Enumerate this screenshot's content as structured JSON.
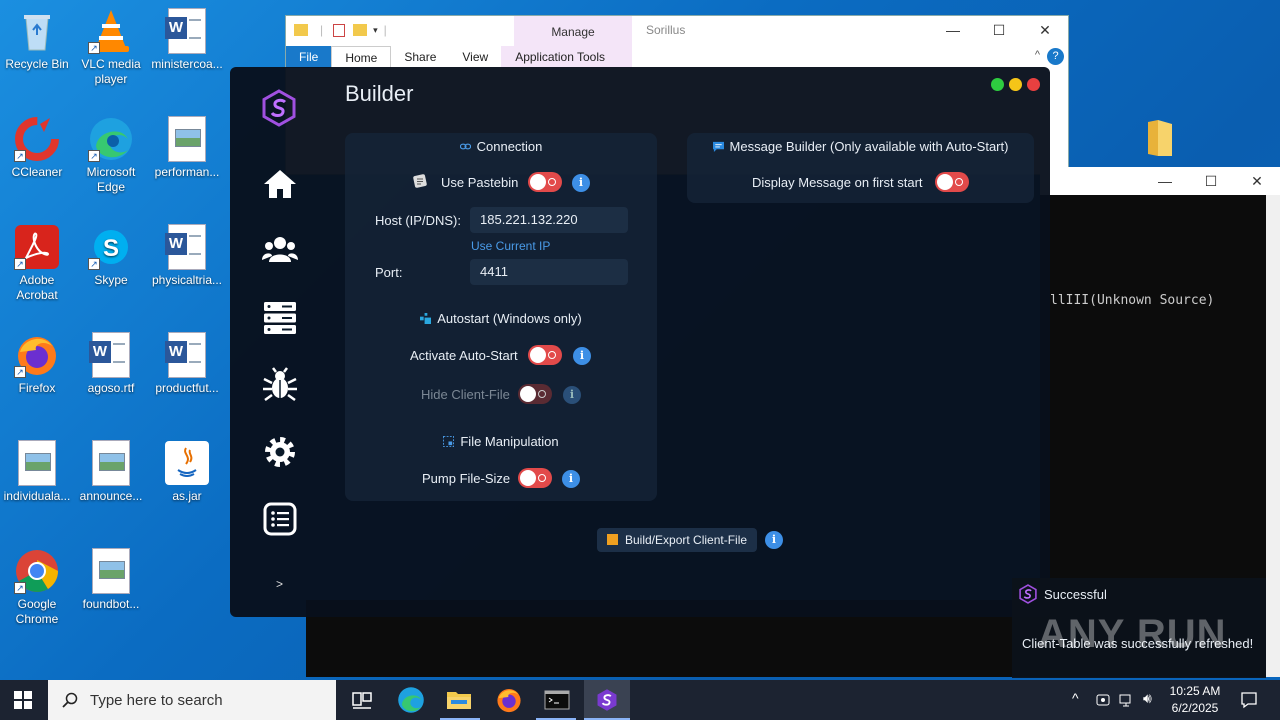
{
  "desktop": {
    "icons": [
      {
        "label": "Recycle Bin",
        "icon": "recycle-bin-icon"
      },
      {
        "label": "VLC media player",
        "icon": "vlc-icon"
      },
      {
        "label": "ministercoa...",
        "icon": "word-doc-icon"
      },
      {
        "label": "CCleaner",
        "icon": "ccleaner-icon"
      },
      {
        "label": "Microsoft Edge",
        "icon": "edge-icon"
      },
      {
        "label": "performan...",
        "icon": "image-file-icon"
      },
      {
        "label": "Adobe Acrobat",
        "icon": "acrobat-icon"
      },
      {
        "label": "Skype",
        "icon": "skype-icon"
      },
      {
        "label": "physicaltria...",
        "icon": "word-doc-icon"
      },
      {
        "label": "Firefox",
        "icon": "firefox-icon"
      },
      {
        "label": "agoso.rtf",
        "icon": "word-doc-icon"
      },
      {
        "label": "productfut...",
        "icon": "word-doc-icon"
      },
      {
        "label": "individuala...",
        "icon": "image-file-icon"
      },
      {
        "label": "announce...",
        "icon": "image-file-icon"
      },
      {
        "label": "as.jar",
        "icon": "java-icon"
      },
      {
        "label": "Google Chrome",
        "icon": "chrome-icon"
      },
      {
        "label": "foundbot...",
        "icon": "image-file-icon"
      }
    ]
  },
  "explorer": {
    "title": "Sorillus",
    "manage_label": "Manage",
    "tabs": [
      "File",
      "Home",
      "Share",
      "View",
      "Application Tools"
    ]
  },
  "console": {
    "text": "llIII(Unknown Source)"
  },
  "app": {
    "title": "Builder",
    "nav": [
      "home-icon",
      "users-icon",
      "server-icon",
      "bug-icon",
      "settings-icon",
      "list-icon"
    ],
    "chevron": ">",
    "connection": {
      "title": "Connection",
      "use_pastebin": "Use Pastebin",
      "host_label": "Host (IP/DNS):",
      "host_value": "185.221.132.220",
      "use_current_ip": "Use Current IP",
      "port_label": "Port:",
      "port_value": "4411"
    },
    "autostart": {
      "title": "Autostart (Windows only)",
      "activate": "Activate Auto-Start",
      "hide_client": "Hide Client-File"
    },
    "file_manipulation": {
      "title": "File Manipulation",
      "pump": "Pump File-Size"
    },
    "message_builder": {
      "title": "Message Builder (Only available with Auto-Start)",
      "display": "Display Message on first start"
    },
    "build_button": "Build/Export Client-File",
    "info_glyph": "i"
  },
  "notification": {
    "title": "Successful",
    "message": "Client-Table was successfully refreshed!"
  },
  "watermark": "ANY RUN",
  "taskbar": {
    "search_placeholder": "Type here to search",
    "time": "10:25 AM",
    "date": "6/2/2025"
  },
  "colors": {
    "accent": "#3d8fe6",
    "toggle_off": "#e24a4a",
    "brand": "#a050e0"
  }
}
